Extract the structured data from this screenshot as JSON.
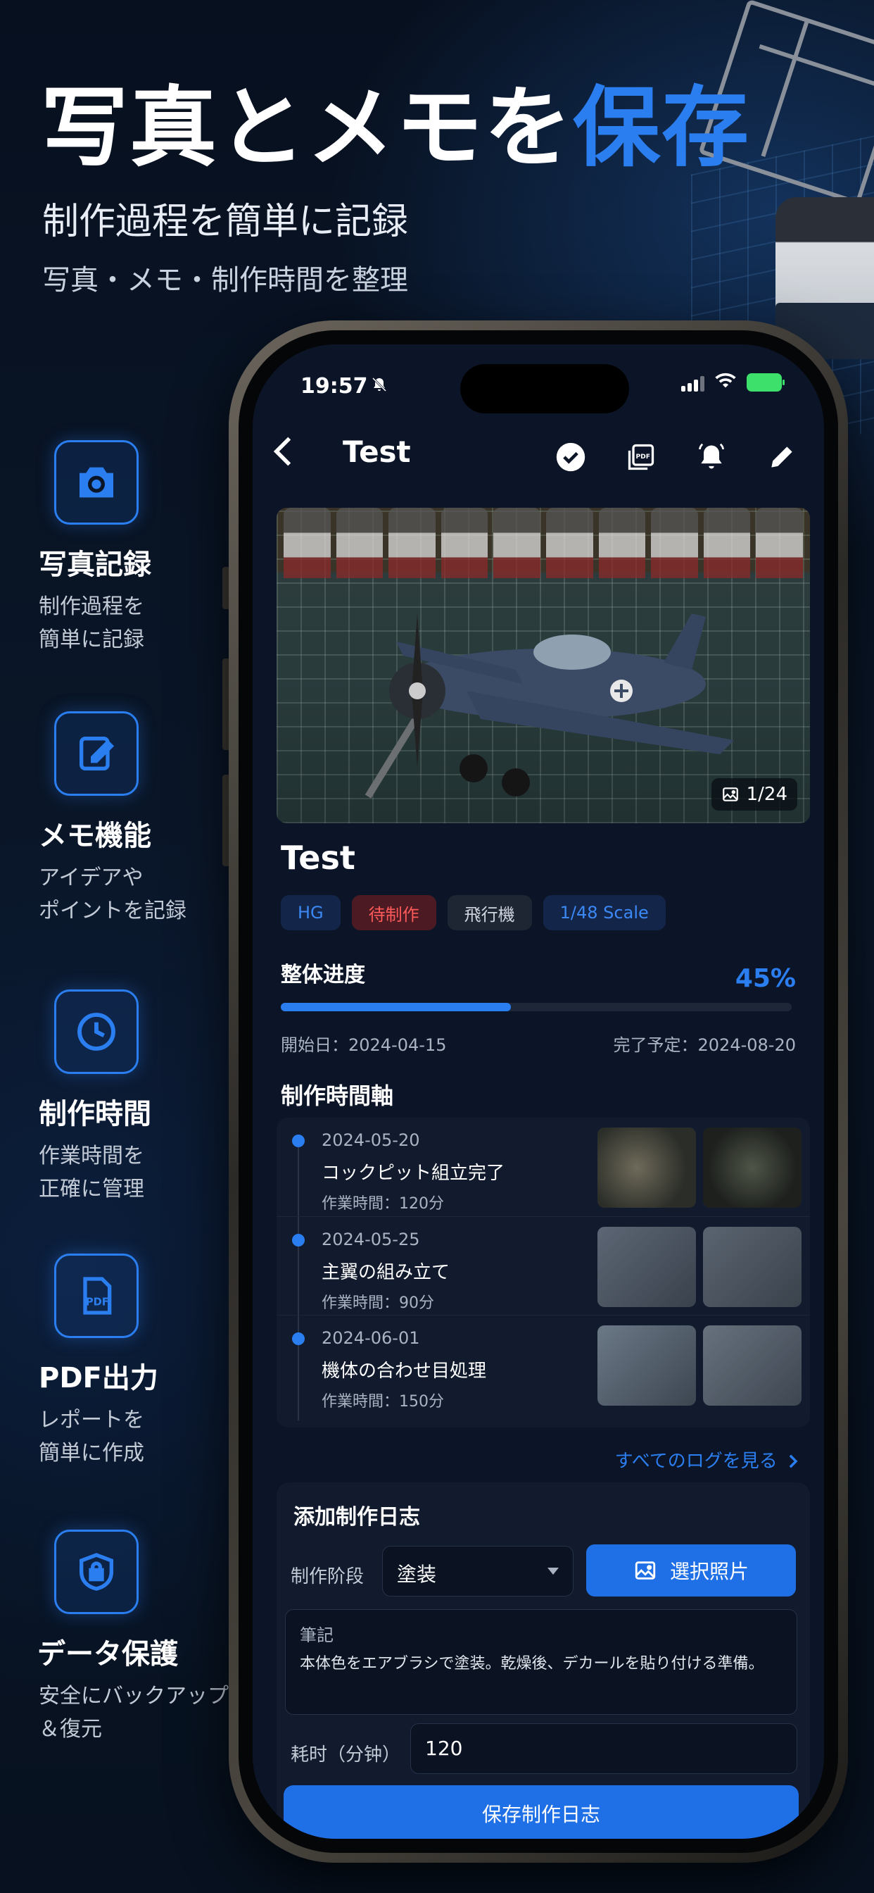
{
  "hero": {
    "title_main": "写真とメモを",
    "title_accent": "保存",
    "subtitle": "制作過程を簡単に記録",
    "subtitle2": "写真・メモ・制作時間を整理"
  },
  "features": [
    {
      "icon": "camera-icon",
      "title": "写真記録",
      "desc": "制作過程を\n簡単に記録"
    },
    {
      "icon": "edit-note-icon",
      "title": "メモ機能",
      "desc": "アイデアや\nポイントを記録"
    },
    {
      "icon": "clock-icon",
      "title": "制作時間",
      "desc": "作業時間を\n正確に管理"
    },
    {
      "icon": "pdf-file-icon",
      "title": "PDF出力",
      "desc": "レポートを\n簡単に作成"
    },
    {
      "icon": "shield-lock-icon",
      "title": "データ保護",
      "desc": "安全にバックアップ\n＆復元"
    }
  ],
  "status": {
    "time": "19:57"
  },
  "nav": {
    "title": "Test"
  },
  "photo": {
    "counter": "1/24"
  },
  "kit": {
    "title": "Test",
    "tags": [
      "HG",
      "待制作",
      "飛行機",
      "1/48 Scale"
    ]
  },
  "progress": {
    "label": "整体进度",
    "percent_text": "45%",
    "value": 0.45,
    "start": "開始日：2024-04-15",
    "end": "完了予定：2024-08-20"
  },
  "timeline": {
    "title": "制作時間軸",
    "items": [
      {
        "date": "2024-05-20",
        "name": "コックピット組立完了",
        "time": "作業時間：120分"
      },
      {
        "date": "2024-05-25",
        "name": "主翼の組み立て",
        "time": "作業時間：90分"
      },
      {
        "date": "2024-06-01",
        "name": "機体の合わせ目処理",
        "time": "作業時間：150分"
      }
    ],
    "see_all": "すべてのログを見る"
  },
  "form": {
    "title": "添加制作日志",
    "stage_label": "制作阶段",
    "stage_value": "塗装",
    "photo_button": "選択照片",
    "note_label": "筆記",
    "note_text": "本体色をエアブラシで塗装。乾燥後、デカールを貼り付ける準備。",
    "duration_label": "耗时（分钟）",
    "duration_value": "120",
    "save_button": "保存制作日志"
  },
  "colors": {
    "accent": "#2b7ef0",
    "background": "#0a1628",
    "tag_red": "#ff5a5a"
  }
}
